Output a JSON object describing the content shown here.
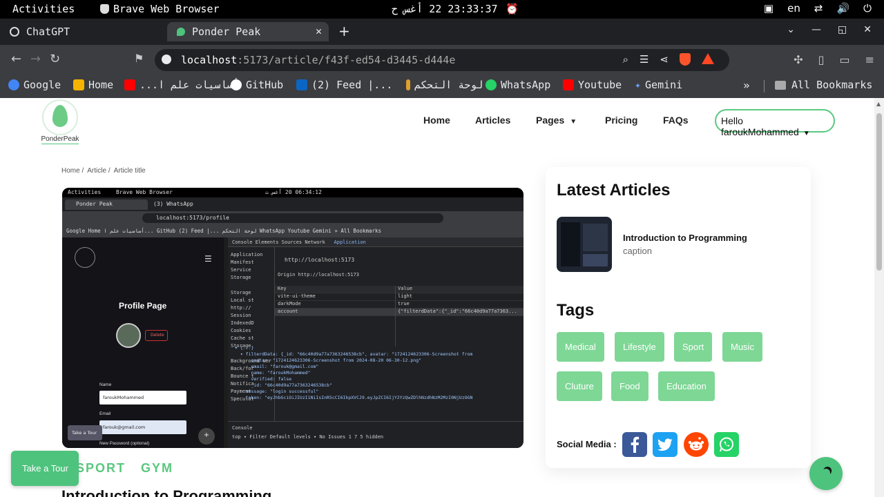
{
  "system_bar": {
    "activities": "Activities",
    "app_name": "Brave Web Browser",
    "clock": "23:33:37 22 أغس ح",
    "lang": "en"
  },
  "tabs": [
    {
      "title": "ChatGPT"
    },
    {
      "title": "Ponder Peak"
    }
  ],
  "address": {
    "host": "localhost",
    "path": ":5173/article/f43f-ed54-d3445-d444e"
  },
  "bookmarks": [
    {
      "label": "Google",
      "color": "#4285f4"
    },
    {
      "label": "Home",
      "color": "#f4b400"
    },
    {
      "label": "أساسيات علم ا...",
      "color": "#ff0000"
    },
    {
      "label": "GitHub",
      "color": "#ffffff"
    },
    {
      "label": "(2) Feed |...",
      "color": "#0a66c2"
    },
    {
      "label": "لوحة التحكم",
      "color": "#e0a030"
    },
    {
      "label": "WhatsApp",
      "color": "#25d366"
    },
    {
      "label": "Youtube",
      "color": "#ff0000"
    },
    {
      "label": "Gemini",
      "color": "#6aa0ff"
    }
  ],
  "all_bookmarks": "All Bookmarks",
  "site": {
    "logo_text": "PonderPeak",
    "nav": {
      "home": "Home",
      "articles": "Articles",
      "pages": "Pages",
      "pricing": "Pricing",
      "faqs": "FAQs"
    },
    "user_menu": "Hello faroukMohammed",
    "breadcrumb": [
      "Home",
      "Article",
      "Article title"
    ],
    "categories": [
      "SPORT",
      "GYM"
    ],
    "article_title": "Introduction to Programming",
    "take_tour": "Take a Tour"
  },
  "hero_screenshot": {
    "top": {
      "activities": "Activities",
      "app": "Brave Web Browser",
      "clock": "06:34:12 20 أغس ث"
    },
    "tab1": "Ponder Peak",
    "tab2": "(3) WhatsApp",
    "url": "localhost:5173/profile",
    "bookmarks": "Google  Home  أساسيات علم ا...  GitHub  (2) Feed |...  لوحة التحكم  WhatsApp  Youtube  Gemini   »   All Bookmarks",
    "profile_title": "Profile Page",
    "delete": "Delete",
    "name_label": "Name",
    "name_value": "faroukMohammed",
    "email_label": "Email",
    "email_value": "farouk@gmail.com",
    "password_label": "New Password (optional)",
    "take_tour": "Take a Tour",
    "devtools_tabs": "Console   Elements   Sources   Network",
    "devtools_active": "Application",
    "left_panel": [
      "Application",
      "Manifest",
      "Service",
      "Storage",
      "",
      "Storage",
      "Local st",
      "http://",
      "Session",
      "IndexedD",
      "Cookies",
      "Cache st",
      "Storage",
      "",
      "Background ser",
      "Back/for",
      "Bounce t",
      "Notifica",
      "Payment",
      "Speculat"
    ],
    "origin_url": "http://localhost:5173",
    "origin_label": "Origin  http://localhost:5173",
    "table_head": {
      "key": "Key",
      "value": "Value"
    },
    "rows": [
      {
        "key": "vite-ui-theme",
        "value": "light"
      },
      {
        "key": "darkMode",
        "value": "true"
      },
      {
        "key": "account",
        "value": "{\"filterdData\":{\"_id\":\"66c40d9a77a7363..."
      }
    ],
    "json_lines": [
      "▾ {...}",
      "  ▾ filterdData: {_id: \"66c40d9a77a7363246538cb\", avatar: \"1724124623306-Screenshot from 202",
      "      avatar: \"1724124623306-Screenshot from 2024-08-20 06-30-12.png\"",
      "      email: \"farouk@gmail.com\"",
      "      name: \"faroukMohammed\"",
      "      verified: false",
      "      _id: \"66c40d9a77a7363246538cb\"",
      "    message: \"login successful\"",
      "    token: \"eyJhbGciOiJIUzI1NiIsInR5cCI6IkpXVCJ9.eyJpZCI6IjY2YzQwZDlhNzdhNzM2MzI0NjUzOGNiIiwi"
    ],
    "console_label": "Console",
    "console_bar": "top ▾   Filter        Default levels ▾    No Issues  1  7    5 hidden"
  },
  "sidebar": {
    "latest_title": "Latest Articles",
    "article": {
      "title": "Introduction to Programming",
      "caption": "caption"
    },
    "tags_title": "Tags",
    "tags": [
      "Medical",
      "Lifestyle",
      "Sport",
      "Music",
      "Cluture",
      "Food",
      "Education"
    ],
    "social_label": "Social Media :",
    "social": [
      {
        "name": "facebook-icon",
        "color": "#3b5998"
      },
      {
        "name": "twitter-icon",
        "color": "#1da1f2"
      },
      {
        "name": "reddit-icon",
        "color": "#ff4500"
      },
      {
        "name": "whatsapp-icon",
        "color": "#25d366"
      }
    ]
  },
  "accent_color": "#4ec37d"
}
